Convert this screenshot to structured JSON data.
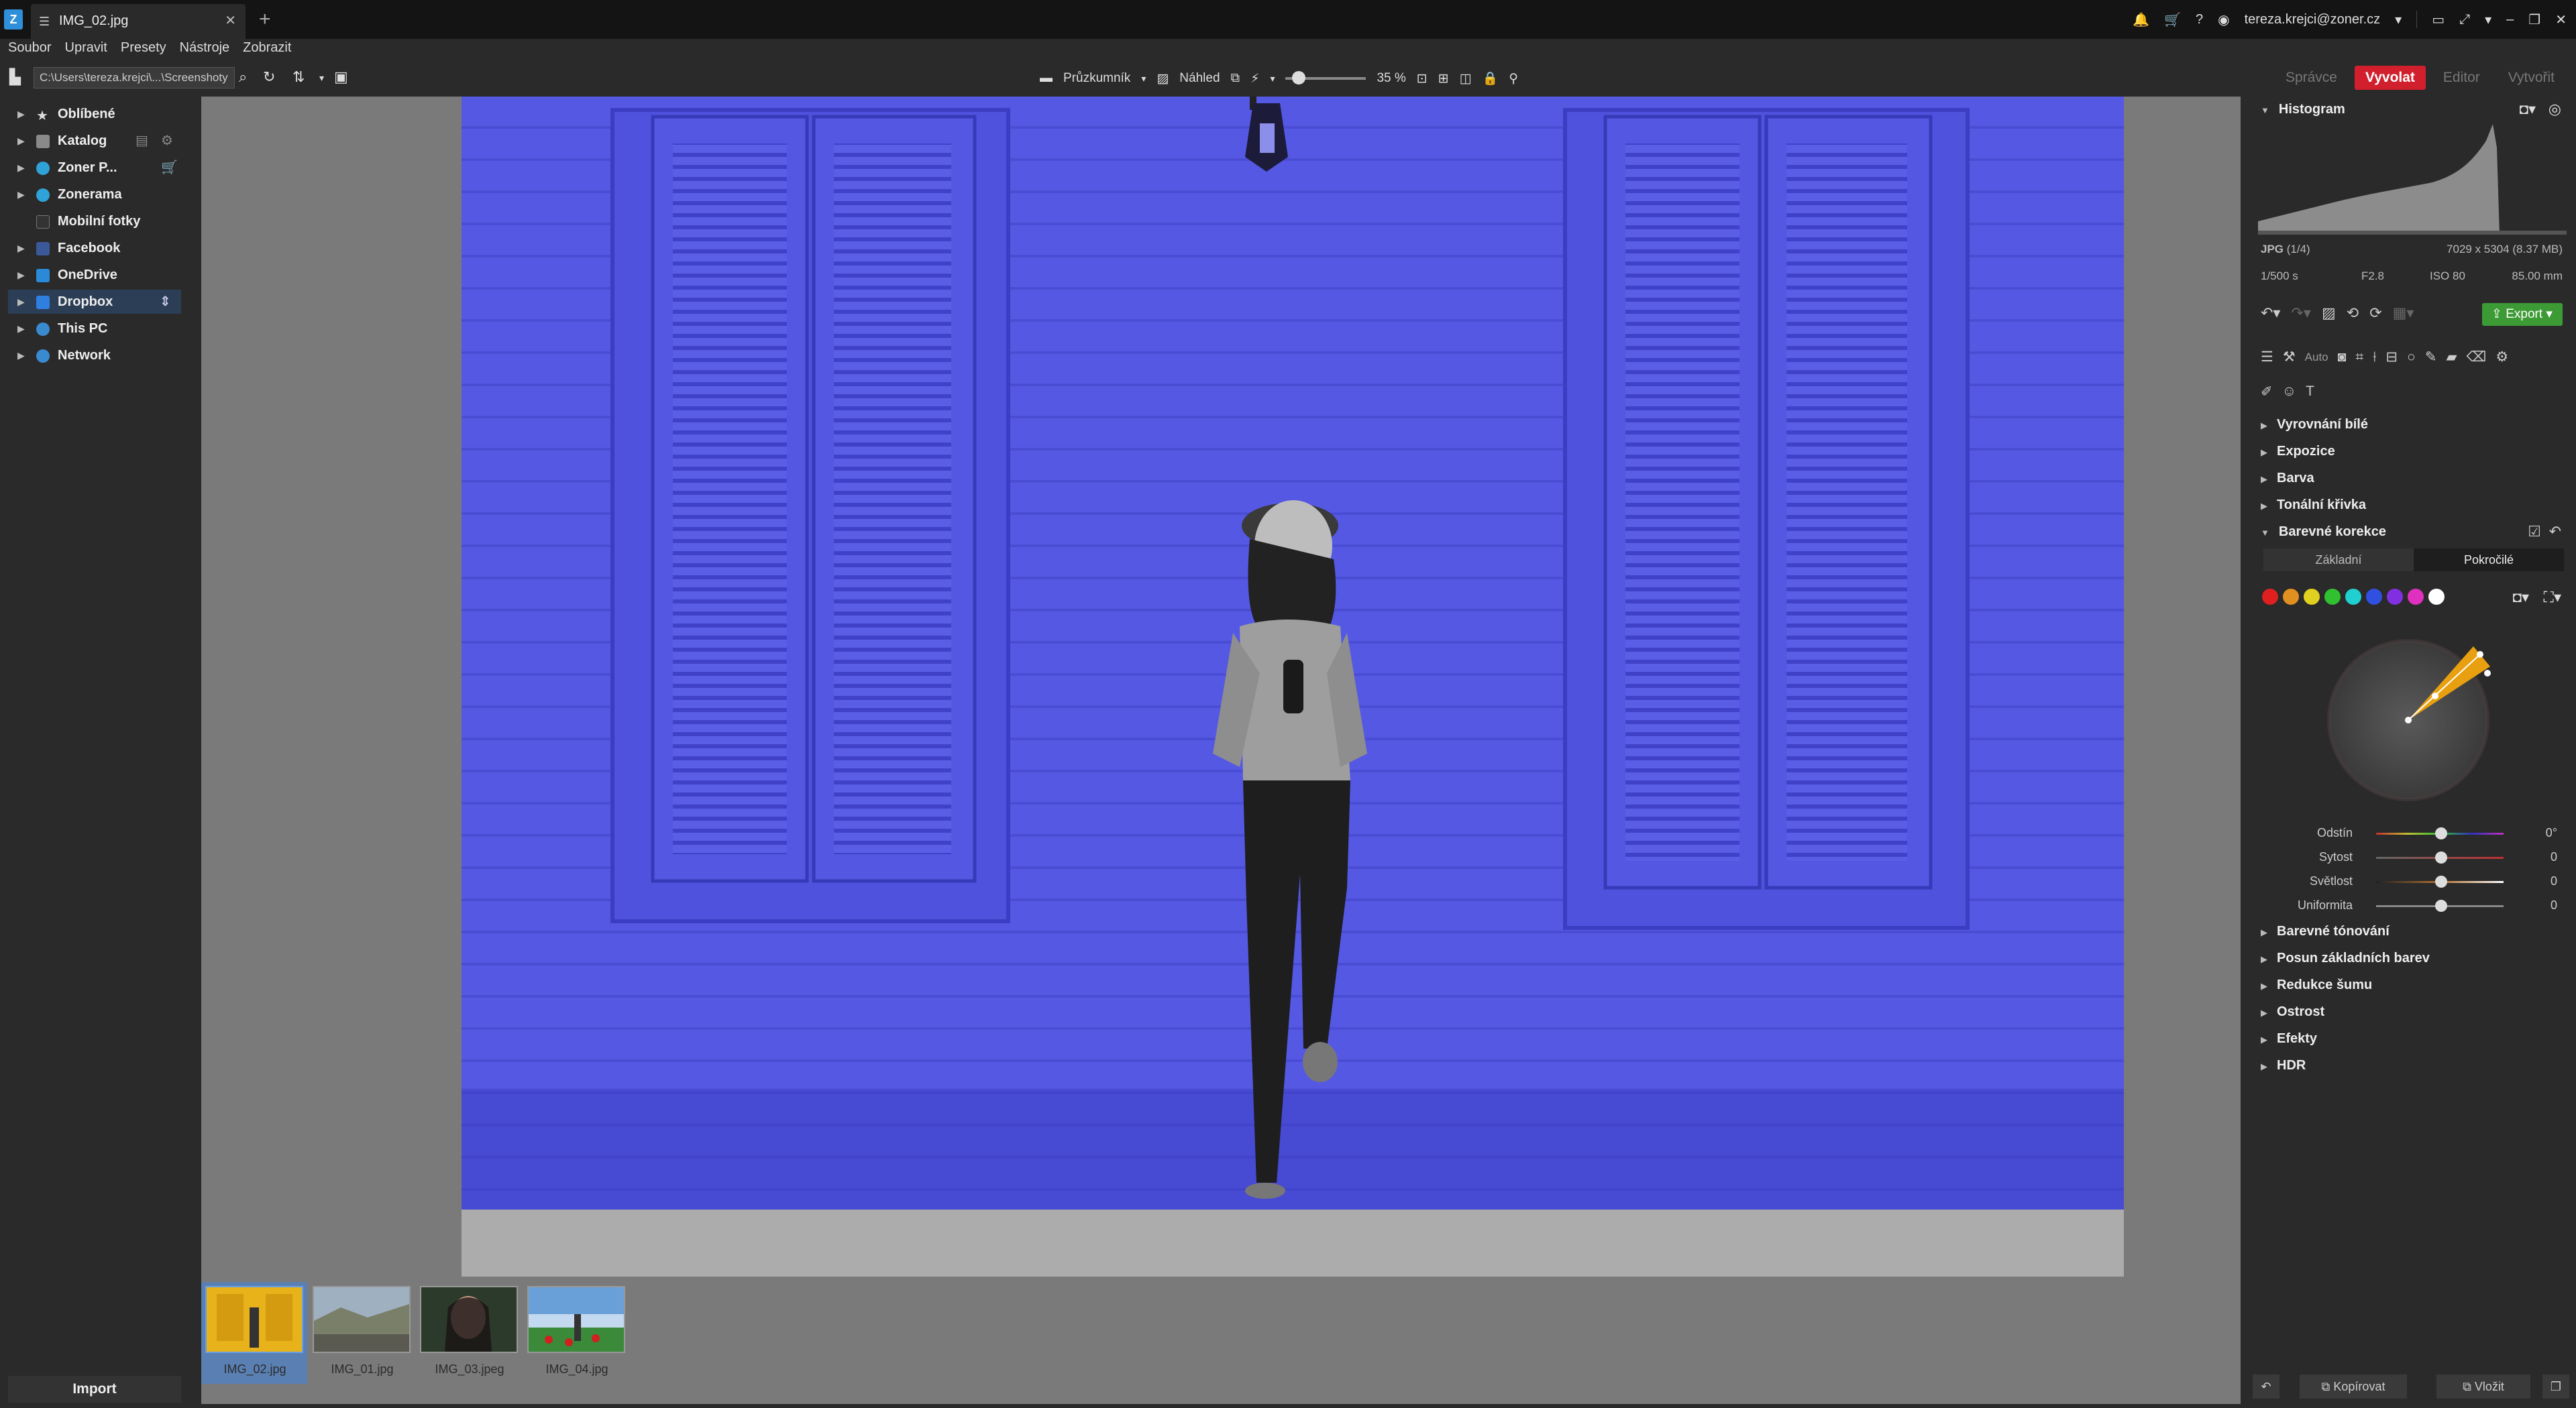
{
  "titlebar": {
    "app_logo": "Z",
    "tab_title": "IMG_02.jpg",
    "user": "tereza.krejci@zoner.cz"
  },
  "menu": [
    "Soubor",
    "Upravit",
    "Presety",
    "Nástroje",
    "Zobrazit"
  ],
  "toolbar": {
    "path": "C:\\Users\\tereza.krejci\\...\\Screenshoty",
    "explorer_label": "Průzkumník",
    "preview_label": "Náhled",
    "zoom": "35 %"
  },
  "modes": {
    "manager": "Správce",
    "develop": "Vyvolat",
    "editor": "Editor",
    "create": "Vytvořit"
  },
  "nav": [
    {
      "label": "Oblíbené"
    },
    {
      "label": "Katalog"
    },
    {
      "label": "Zoner P..."
    },
    {
      "label": "Zonerama"
    },
    {
      "label": "Mobilní fotky"
    },
    {
      "label": "Facebook"
    },
    {
      "label": "OneDrive"
    },
    {
      "label": "Dropbox"
    },
    {
      "label": "This PC"
    },
    {
      "label": "Network"
    }
  ],
  "import_label": "Import",
  "filmstrip": [
    {
      "name": "IMG_02.jpg"
    },
    {
      "name": "IMG_01.jpg"
    },
    {
      "name": "IMG_03.jpeg"
    },
    {
      "name": "IMG_04.jpg"
    }
  ],
  "right": {
    "histogram_title": "Histogram",
    "file_type": "JPG",
    "file_index": "(1/4)",
    "dimensions": "7029 x 5304 (8.37 MB)",
    "shutter": "1/500 s",
    "aperture": "F2.8",
    "iso": "ISO 80",
    "focal": "85.00 mm",
    "export_label": "Export",
    "auto_label": "Auto",
    "sections_top": [
      "Vyrovnání bílé",
      "Expozice",
      "Barva",
      "Tonální křivka"
    ],
    "color_corr": "Barevné korekce",
    "tab_basic": "Základní",
    "tab_advanced": "Pokročilé",
    "sliders": [
      {
        "label": "Odstín",
        "value": "0°"
      },
      {
        "label": "Sytost",
        "value": "0"
      },
      {
        "label": "Světlost",
        "value": "0"
      },
      {
        "label": "Uniformita",
        "value": "0"
      }
    ],
    "sections_bottom": [
      "Barevné tónování",
      "Posun základních barev",
      "Redukce šumu",
      "Ostrost",
      "Efekty",
      "HDR"
    ],
    "copy_label": "Kopírovat",
    "paste_label": "Vložit"
  },
  "colors": {
    "accent_red": "#d11f2d",
    "export_green": "#3d9b35",
    "photo_blue": "#5558e3"
  },
  "color_dots": [
    "#e02020",
    "#e09020",
    "#e0d020",
    "#30c030",
    "#20d0d0",
    "#3050e0",
    "#8030e0",
    "#e030c0",
    "#ffffff"
  ]
}
